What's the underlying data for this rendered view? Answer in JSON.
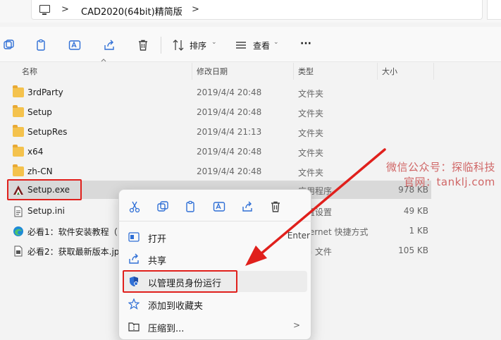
{
  "address": {
    "path": "CAD2020(64bit)精简版",
    "separator": ">"
  },
  "toolbar": {
    "sort_label": "排序",
    "view_label": "查看",
    "more_label": "···"
  },
  "columns": {
    "name": "名称",
    "date": "修改日期",
    "type": "类型",
    "size": "大小"
  },
  "files": [
    {
      "name": "3rdParty",
      "date": "2019/4/4 20:48",
      "type": "文件夹",
      "size": "",
      "icon": "folder-icon"
    },
    {
      "name": "Setup",
      "date": "2019/4/4 20:48",
      "type": "文件夹",
      "size": "",
      "icon": "folder-icon"
    },
    {
      "name": "SetupRes",
      "date": "2019/4/4 21:13",
      "type": "文件夹",
      "size": "",
      "icon": "folder-icon"
    },
    {
      "name": "x64",
      "date": "2019/4/4 20:48",
      "type": "文件夹",
      "size": "",
      "icon": "folder-icon"
    },
    {
      "name": "zh-CN",
      "date": "2019/4/4 20:48",
      "type": "文件夹",
      "size": "",
      "icon": "folder-icon"
    },
    {
      "name": "Setup.exe",
      "date": "",
      "type": "应用程序",
      "size": "978 KB",
      "icon": "autocad-app-icon"
    },
    {
      "name": "Setup.ini",
      "date": "",
      "type": "配置设置",
      "size": "49 KB",
      "icon": "ini-file-icon"
    },
    {
      "name": "必看1：软件安装教程（",
      "date": "",
      "type": "Internet 快捷方式",
      "size": "1 KB",
      "icon": "edge-shortcut-icon"
    },
    {
      "name": "必看2：获取最新版本.jp",
      "date": "",
      "type": "JPG 文件",
      "size": "105 KB",
      "icon": "image-file-icon"
    }
  ],
  "watermark": {
    "line1": "微信公众号：探临科技",
    "line2": "官网：tanklj.com"
  },
  "context_menu": {
    "items": [
      {
        "label": "打开",
        "shortcut": "Enter"
      },
      {
        "label": "共享",
        "shortcut": ""
      },
      {
        "label": "以管理员身份运行",
        "shortcut": ""
      },
      {
        "label": "添加到收藏夹",
        "shortcut": ""
      },
      {
        "label": "压缩到...",
        "shortcut": ">"
      }
    ]
  },
  "colors": {
    "highlight_red": "#e0201c",
    "selected_row": "#d9d9d9",
    "folder": "#f4c24d"
  }
}
